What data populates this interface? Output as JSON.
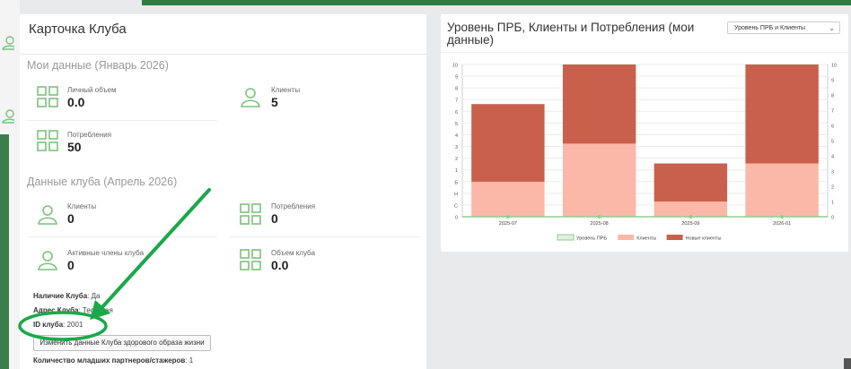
{
  "club_card": {
    "title": "Карточка Клуба",
    "my_data": {
      "title": "Мои данные (Январь 2026)",
      "personal_volume": {
        "label": "Личный объем",
        "value": "0.0"
      },
      "clients": {
        "label": "Клиенты",
        "value": "5"
      },
      "consumption": {
        "label": "Потребления",
        "value": "50"
      }
    },
    "club_data": {
      "title": "Данные клуба (Апрель 2026)",
      "clients": {
        "label": "Клиенты",
        "value": "0"
      },
      "consumption": {
        "label": "Потребления",
        "value": "0"
      },
      "active_members": {
        "label": "Активные члены клуба",
        "value": "0"
      },
      "club_volume": {
        "label": "Объем клуба",
        "value": "0.0"
      }
    },
    "info": {
      "club_presence_label": "Наличие Клуба",
      "club_presence_value": "Да",
      "club_address_label": "Адрес Клуба",
      "club_address_value": "Тестовая",
      "club_id_label": "ID клуба",
      "club_id_value": "2001",
      "edit_button": "Изменить данные Клуба здорового образа жизни",
      "junior_partners_label": "Количество младших партнеров/стажеров",
      "junior_partners_value": "1"
    }
  },
  "chart_panel": {
    "title": "Уровень ПРБ, Клиенты и Потребления (мои данные)",
    "select_value": "Уровень ПРБ и Клиенты"
  },
  "chart_data": {
    "type": "bar",
    "stacked": true,
    "categories": [
      "2025-07",
      "2025-08",
      "2025-09",
      "2026-01"
    ],
    "series": [
      {
        "name": "Уровень ПРБ",
        "kind": "line",
        "color": "#8fce8f",
        "values": [
          0,
          0,
          0,
          0
        ]
      },
      {
        "name": "Клиенты",
        "color": "#fbb7a8",
        "values": [
          2.3,
          4.8,
          1.0,
          3.5
        ]
      },
      {
        "name": "Новые клиенты",
        "color": "#c9604c",
        "values": [
          5.1,
          5.2,
          2.5,
          6.5
        ]
      }
    ],
    "y_left_ticks": [
      "0",
      "С",
      "Н",
      "Б",
      "1",
      "2",
      "3",
      "4",
      "5",
      "6",
      "7",
      "8",
      "9",
      "10"
    ],
    "y_right_ticks": [
      "0",
      "1",
      "2",
      "3",
      "4",
      "5",
      "6",
      "7",
      "8",
      "9",
      "10"
    ],
    "ylim": [
      0,
      10
    ],
    "grid": true,
    "legend_position": "bottom"
  },
  "colors": {
    "accent_green": "#5cb85c",
    "annotation_green": "#1aa84a"
  },
  "icons": [
    "grid-icon",
    "user-icon",
    "arrow-annotation"
  ]
}
